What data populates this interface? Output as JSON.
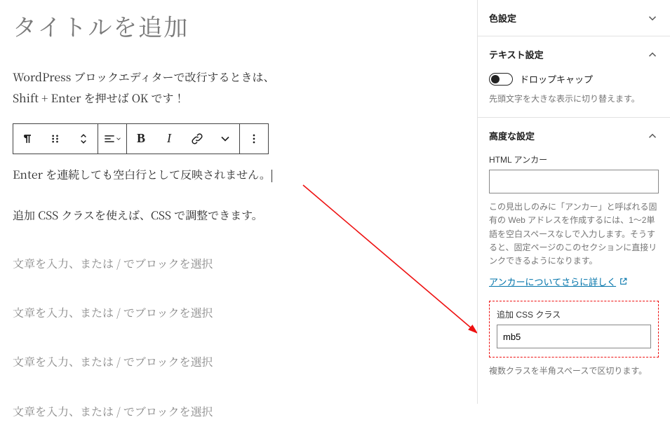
{
  "title_placeholder": "タイトルを追加",
  "paragraphs": {
    "p1a": "WordPress ブロックエディターで改行するときは、",
    "p1b": "Shift + Enter を押せば OK です！",
    "p_current": "Enter を連続しても空白行として反映されません。",
    "p3": "追加 CSS クラスを使えば、CSS で調整できます。",
    "placeholder": "文章を入力、または / でブロックを選択"
  },
  "toolbar": {
    "block_type": "paragraph-icon",
    "drag": "drag-icon",
    "mover": "mover-icon",
    "align": "align-icon",
    "bold": "B",
    "italic": "I",
    "link": "link-icon",
    "more_rich": "more-rich-icon",
    "options": "options-icon"
  },
  "sidebar": {
    "color": {
      "title": "色設定"
    },
    "text": {
      "title": "テキスト設定",
      "dropcap_label": "ドロップキャップ",
      "dropcap_hint": "先頭文字を大きな表示に切り替えます。"
    },
    "advanced": {
      "title": "高度な設定",
      "anchor_label": "HTML アンカー",
      "anchor_value": "",
      "anchor_hint": "この見出しのみに「アンカー」と呼ばれる固有の Web アドレスを作成するには、1〜2単語を空白スペースなしで入力します。そうすると、固定ページのこのセクションに直接リンクできるようになります。",
      "anchor_link": "アンカーについてさらに詳しく",
      "css_label": "追加 CSS クラス",
      "css_value": "mb5",
      "css_hint": "複数クラスを半角スペースで区切ります。"
    }
  }
}
